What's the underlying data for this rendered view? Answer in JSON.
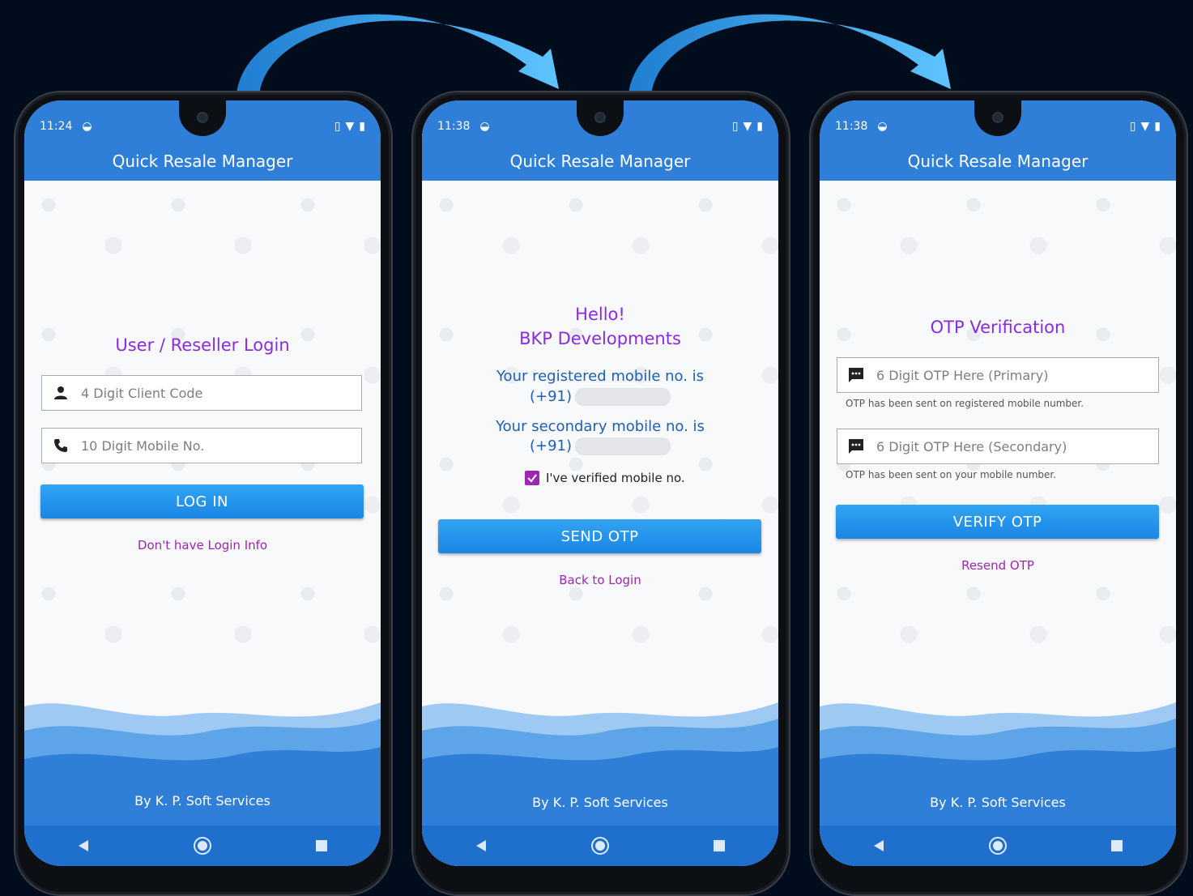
{
  "app_title": "Quick Resale Manager",
  "footer_credit": "By K. P. Soft Services",
  "colors": {
    "primary": "#2f7fd8",
    "accent_purple": "#8a2be2",
    "link_purple": "#9c27b0",
    "button_blue": "#1a86e6",
    "background": "#010c1d"
  },
  "screens": [
    {
      "status_time": "11:24",
      "heading": "User / Reseller Login",
      "client_code_placeholder": "4 Digit Client Code",
      "client_code_icon": "person-icon",
      "mobile_placeholder": "10 Digit Mobile No.",
      "mobile_icon": "phone-icon",
      "button_label": "LOG IN",
      "link_label": "Don't have Login Info"
    },
    {
      "status_time": "11:38",
      "greeting": "Hello!",
      "user_name": "BKP Developments",
      "registered_label": "Your registered mobile no. is",
      "registered_prefix": "(+91)",
      "secondary_label": "Your secondary mobile no. is",
      "secondary_prefix": "(+91)",
      "verified_checkbox_label": "I've verified mobile no.",
      "verified_checked": true,
      "button_label": "SEND OTP",
      "link_label": "Back to Login"
    },
    {
      "status_time": "11:38",
      "heading": "OTP Verification",
      "otp_primary_placeholder": "6 Digit OTP Here (Primary)",
      "otp_primary_hint": "OTP has been sent on registered mobile number.",
      "otp_secondary_placeholder": "6 Digit OTP Here (Secondary)",
      "otp_secondary_hint": "OTP has been sent on your mobile number.",
      "button_label": "VERIFY OTP",
      "link_label": "Resend OTP"
    }
  ]
}
